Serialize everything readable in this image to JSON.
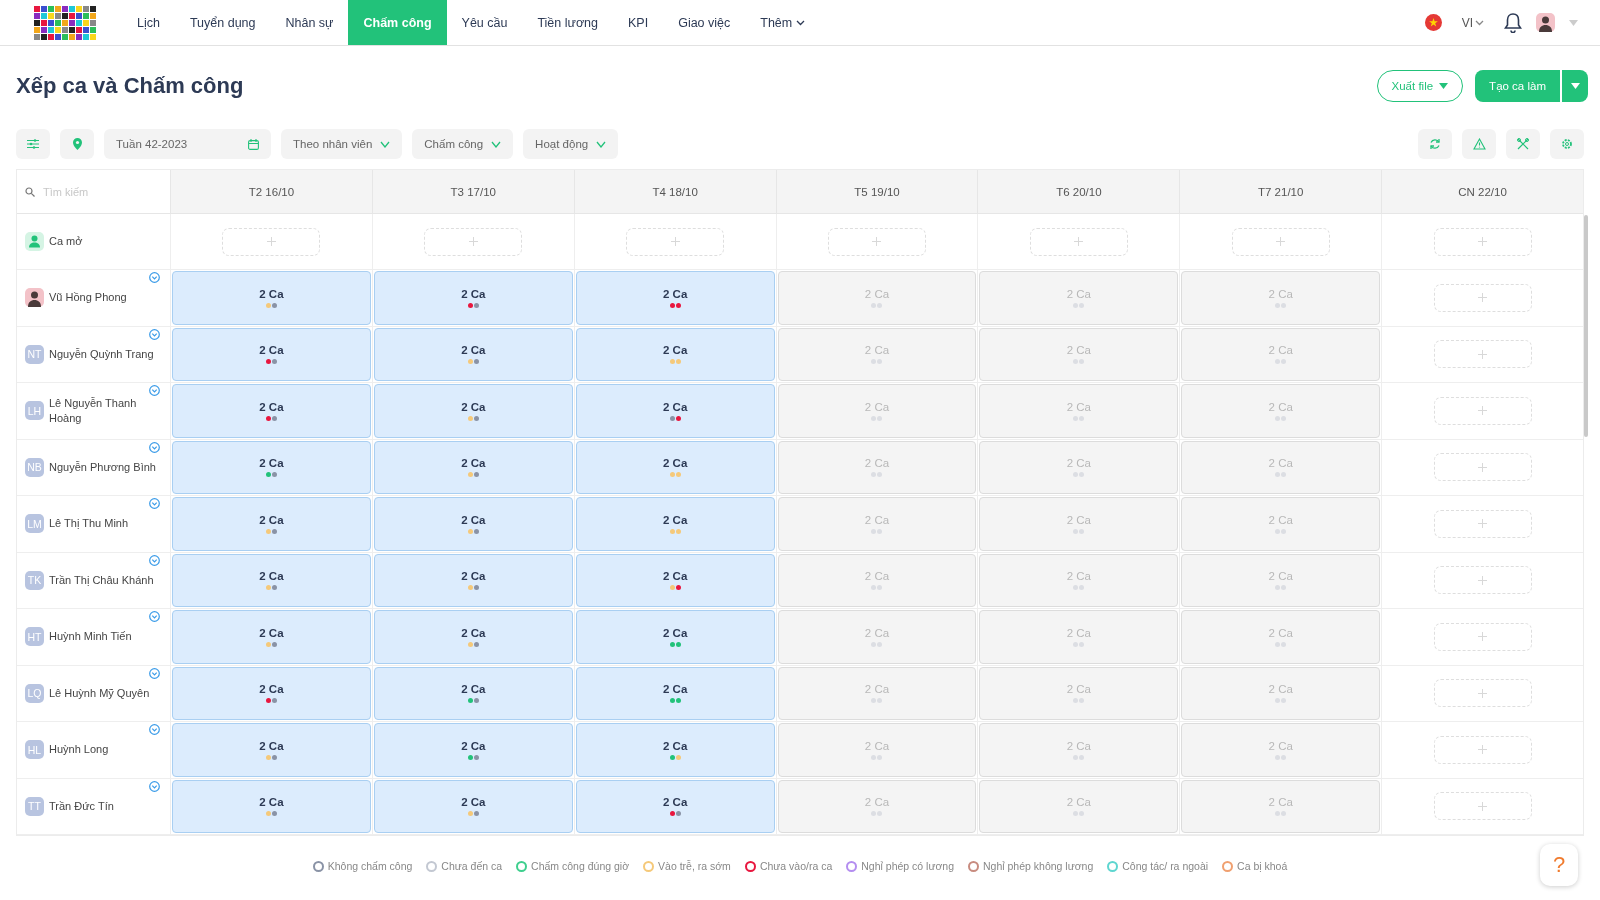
{
  "nav": [
    {
      "label": "Lịch",
      "selected": false
    },
    {
      "label": "Tuyển dụng",
      "selected": false
    },
    {
      "label": "Nhân sự",
      "selected": false
    },
    {
      "label": "Chấm công",
      "selected": true
    },
    {
      "label": "Yêu cầu",
      "selected": false
    },
    {
      "label": "Tiền lương",
      "selected": false
    },
    {
      "label": "KPI",
      "selected": false
    },
    {
      "label": "Giao việc",
      "selected": false
    },
    {
      "label": "Thêm",
      "selected": false,
      "kind": "menu"
    }
  ],
  "language": "VI",
  "title": "Xếp ca và Chấm công",
  "export_button": "Xuất file",
  "create_button": "Tạo ca làm",
  "week_field": "Tuần 42-2023",
  "filters": [
    "Theo nhân viên",
    "Chấm công",
    "Hoạt động"
  ],
  "search": {
    "placeholder": "Tìm kiếm"
  },
  "days": [
    "T2 16/10",
    "T3 17/10",
    "T4 18/10",
    "T5 19/10",
    "T6 20/10",
    "T7 21/10",
    "CN 22/10"
  ],
  "open_shift": {
    "label": "Ca mở",
    "cells": [
      {
        "kind": "empty"
      },
      {
        "kind": "empty"
      },
      {
        "kind": "empty"
      },
      {
        "kind": "empty"
      },
      {
        "kind": "empty"
      },
      {
        "kind": "empty"
      },
      {
        "kind": "empty"
      }
    ]
  },
  "rows": [
    {
      "name": "Vũ Hồng Phong",
      "avatar": {
        "kind": "photo"
      },
      "cells": [
        {
          "kind": "past",
          "label": "2 Ca",
          "dots": [
            {
              "color": "#f5c97a"
            },
            {
              "color": "#8a93a6"
            }
          ]
        },
        {
          "kind": "past",
          "label": "2 Ca",
          "dots": [
            {
              "color": "#e8173f"
            },
            {
              "color": "#8a93a6"
            }
          ]
        },
        {
          "kind": "past",
          "label": "2 Ca",
          "dots": [
            {
              "color": "#e8173f"
            },
            {
              "color": "#e8173f"
            }
          ]
        },
        {
          "kind": "future",
          "label": "2 Ca"
        },
        {
          "kind": "future",
          "label": "2 Ca"
        },
        {
          "kind": "future",
          "label": "2 Ca"
        },
        {
          "kind": "empty"
        }
      ]
    },
    {
      "name": "Nguyễn Quỳnh Trang",
      "avatar": {
        "kind": "initials",
        "text": "NT"
      },
      "cells": [
        {
          "kind": "past",
          "label": "2 Ca",
          "dots": [
            {
              "color": "#e8173f"
            },
            {
              "color": "#8a93a6"
            }
          ]
        },
        {
          "kind": "past",
          "label": "2 Ca",
          "dots": [
            {
              "color": "#f5c97a"
            },
            {
              "color": "#8a93a6"
            }
          ]
        },
        {
          "kind": "past",
          "label": "2 Ca",
          "dots": [
            {
              "color": "#f5c97a"
            },
            {
              "color": "#f5c97a"
            }
          ]
        },
        {
          "kind": "future",
          "label": "2 Ca"
        },
        {
          "kind": "future",
          "label": "2 Ca"
        },
        {
          "kind": "future",
          "label": "2 Ca"
        },
        {
          "kind": "empty"
        }
      ]
    },
    {
      "name": "Lê Nguyễn Thanh Hoàng",
      "avatar": {
        "kind": "initials",
        "text": "LH"
      },
      "cells": [
        {
          "kind": "past",
          "label": "2 Ca",
          "dots": [
            {
              "color": "#e8173f"
            },
            {
              "color": "#8a93a6"
            }
          ]
        },
        {
          "kind": "past",
          "label": "2 Ca",
          "dots": [
            {
              "color": "#f5c97a"
            },
            {
              "color": "#8a93a6"
            }
          ]
        },
        {
          "kind": "past",
          "label": "2 Ca",
          "dots": [
            {
              "color": "#8a93a6"
            },
            {
              "color": "#e8173f"
            }
          ]
        },
        {
          "kind": "future",
          "label": "2 Ca"
        },
        {
          "kind": "future",
          "label": "2 Ca"
        },
        {
          "kind": "future",
          "label": "2 Ca"
        },
        {
          "kind": "empty"
        }
      ]
    },
    {
      "name": "Nguyễn Phương Bình",
      "avatar": {
        "kind": "initials",
        "text": "NB"
      },
      "cells": [
        {
          "kind": "past",
          "label": "2 Ca",
          "dots": [
            {
              "color": "#22c27a"
            },
            {
              "color": "#8a93a6"
            }
          ]
        },
        {
          "kind": "past",
          "label": "2 Ca",
          "dots": [
            {
              "color": "#f5c97a"
            },
            {
              "color": "#8a93a6"
            }
          ]
        },
        {
          "kind": "past",
          "label": "2 Ca",
          "dots": [
            {
              "color": "#f5c97a"
            },
            {
              "color": "#f5c97a"
            }
          ]
        },
        {
          "kind": "future",
          "label": "2 Ca"
        },
        {
          "kind": "future",
          "label": "2 Ca"
        },
        {
          "kind": "future",
          "label": "2 Ca"
        },
        {
          "kind": "empty"
        }
      ]
    },
    {
      "name": "Lê Thị Thu Minh",
      "avatar": {
        "kind": "initials",
        "text": "LM"
      },
      "cells": [
        {
          "kind": "past",
          "label": "2 Ca",
          "dots": [
            {
              "color": "#f5c97a"
            },
            {
              "color": "#8a93a6"
            }
          ]
        },
        {
          "kind": "past",
          "label": "2 Ca",
          "dots": [
            {
              "color": "#f5c97a"
            },
            {
              "color": "#8a93a6"
            }
          ]
        },
        {
          "kind": "past",
          "label": "2 Ca",
          "dots": [
            {
              "color": "#f5c97a"
            },
            {
              "color": "#f5c97a"
            }
          ]
        },
        {
          "kind": "future",
          "label": "2 Ca"
        },
        {
          "kind": "future",
          "label": "2 Ca"
        },
        {
          "kind": "future",
          "label": "2 Ca"
        },
        {
          "kind": "empty"
        }
      ]
    },
    {
      "name": "Trần Thị Châu Khánh",
      "avatar": {
        "kind": "initials",
        "text": "TK"
      },
      "cells": [
        {
          "kind": "past",
          "label": "2 Ca",
          "dots": [
            {
              "color": "#f5c97a"
            },
            {
              "color": "#8a93a6"
            }
          ]
        },
        {
          "kind": "past",
          "label": "2 Ca",
          "dots": [
            {
              "color": "#f5c97a"
            },
            {
              "color": "#8a93a6"
            }
          ]
        },
        {
          "kind": "past",
          "label": "2 Ca",
          "dots": [
            {
              "color": "#f5c97a"
            },
            {
              "color": "#e8173f"
            }
          ]
        },
        {
          "kind": "future",
          "label": "2 Ca"
        },
        {
          "kind": "future",
          "label": "2 Ca"
        },
        {
          "kind": "future",
          "label": "2 Ca"
        },
        {
          "kind": "empty"
        }
      ]
    },
    {
      "name": "Huỳnh Minh Tiến",
      "avatar": {
        "kind": "initials",
        "text": "HT"
      },
      "cells": [
        {
          "kind": "past",
          "label": "2 Ca",
          "dots": [
            {
              "color": "#f5c97a"
            },
            {
              "color": "#8a93a6"
            }
          ]
        },
        {
          "kind": "past",
          "label": "2 Ca",
          "dots": [
            {
              "color": "#f5c97a"
            },
            {
              "color": "#8a93a6"
            }
          ]
        },
        {
          "kind": "past",
          "label": "2 Ca",
          "dots": [
            {
              "color": "#22c27a"
            },
            {
              "color": "#22c27a"
            }
          ]
        },
        {
          "kind": "future",
          "label": "2 Ca"
        },
        {
          "kind": "future",
          "label": "2 Ca"
        },
        {
          "kind": "future",
          "label": "2 Ca"
        },
        {
          "kind": "empty"
        }
      ]
    },
    {
      "name": "Lê Huỳnh Mỹ Quyên",
      "avatar": {
        "kind": "initials",
        "text": "LQ"
      },
      "cells": [
        {
          "kind": "past",
          "label": "2 Ca",
          "dots": [
            {
              "color": "#e8173f"
            },
            {
              "color": "#8a93a6"
            }
          ]
        },
        {
          "kind": "past",
          "label": "2 Ca",
          "dots": [
            {
              "color": "#22c27a"
            },
            {
              "color": "#8a93a6"
            }
          ]
        },
        {
          "kind": "past",
          "label": "2 Ca",
          "dots": [
            {
              "color": "#22c27a"
            },
            {
              "color": "#22c27a"
            }
          ]
        },
        {
          "kind": "future",
          "label": "2 Ca"
        },
        {
          "kind": "future",
          "label": "2 Ca"
        },
        {
          "kind": "future",
          "label": "2 Ca"
        },
        {
          "kind": "empty"
        }
      ]
    },
    {
      "name": "Huỳnh Long",
      "avatar": {
        "kind": "initials",
        "text": "HL"
      },
      "cells": [
        {
          "kind": "past",
          "label": "2 Ca",
          "dots": [
            {
              "color": "#f5c97a"
            },
            {
              "color": "#8a93a6"
            }
          ]
        },
        {
          "kind": "past",
          "label": "2 Ca",
          "dots": [
            {
              "color": "#22c27a"
            },
            {
              "color": "#8a93a6"
            }
          ]
        },
        {
          "kind": "past",
          "label": "2 Ca",
          "dots": [
            {
              "color": "#22c27a"
            },
            {
              "color": "#f5c97a"
            }
          ]
        },
        {
          "kind": "future",
          "label": "2 Ca"
        },
        {
          "kind": "future",
          "label": "2 Ca"
        },
        {
          "kind": "future",
          "label": "2 Ca"
        },
        {
          "kind": "empty"
        }
      ]
    },
    {
      "name": "Trần Đức Tín",
      "avatar": {
        "kind": "initials",
        "text": "TT"
      },
      "cells": [
        {
          "kind": "past",
          "label": "2 Ca",
          "dots": [
            {
              "color": "#f5c97a"
            },
            {
              "color": "#8a93a6"
            }
          ]
        },
        {
          "kind": "past",
          "label": "2 Ca",
          "dots": [
            {
              "color": "#f5c97a"
            },
            {
              "color": "#8a93a6"
            }
          ]
        },
        {
          "kind": "past",
          "label": "2 Ca",
          "dots": [
            {
              "color": "#e8173f"
            },
            {
              "color": "#8a93a6"
            }
          ]
        },
        {
          "kind": "future",
          "label": "2 Ca"
        },
        {
          "kind": "future",
          "label": "2 Ca"
        },
        {
          "kind": "future",
          "label": "2 Ca"
        },
        {
          "kind": "empty"
        }
      ]
    }
  ],
  "legend": [
    {
      "label": "Không chấm công",
      "color": "#8a93a6"
    },
    {
      "label": "Chưa đến ca",
      "color": "#c3c8d2"
    },
    {
      "label": "Chấm công đúng giờ",
      "color": "#3fcf8e"
    },
    {
      "label": "Vào trễ, ra sớm",
      "color": "#f5c97a"
    },
    {
      "label": "Chưa vào/ra ca",
      "color": "#e8173f"
    },
    {
      "label": "Nghỉ phép có lương",
      "color": "#b48ef0"
    },
    {
      "label": "Nghỉ phép không lương",
      "color": "#c88c80"
    },
    {
      "label": "Công tác/ ra ngoài",
      "color": "#5fd6d0"
    },
    {
      "label": "Ca bị khoá",
      "color": "#f0a070"
    }
  ],
  "help": "?"
}
